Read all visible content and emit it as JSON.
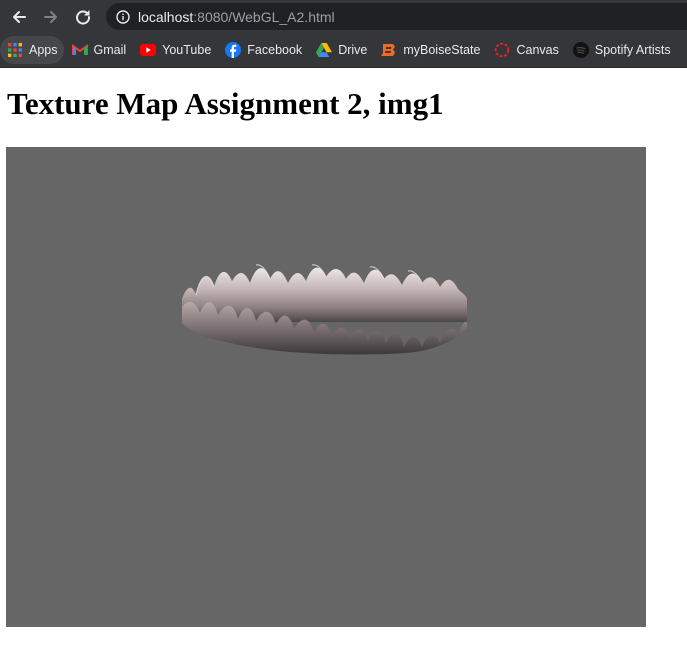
{
  "browser": {
    "url_host": "localhost",
    "url_rest": ":8080/WebGL_A2.html",
    "back_icon": "arrow-left-icon",
    "forward_icon": "arrow-right-icon",
    "reload_icon": "reload-icon",
    "site_info_icon": "info-circle-icon"
  },
  "bookmarks": [
    {
      "label": "Apps",
      "icon": "apps-grid-icon"
    },
    {
      "label": "Gmail",
      "icon": "gmail-icon"
    },
    {
      "label": "YouTube",
      "icon": "youtube-icon"
    },
    {
      "label": "Facebook",
      "icon": "facebook-icon"
    },
    {
      "label": "Drive",
      "icon": "drive-icon"
    },
    {
      "label": "myBoiseState",
      "icon": "boise-state-icon"
    },
    {
      "label": "Canvas",
      "icon": "canvas-icon"
    },
    {
      "label": "Spotify Artists",
      "icon": "spotify-icon"
    }
  ],
  "page": {
    "title": "Texture Map Assignment 2, img1",
    "canvas_background": "#666666"
  }
}
